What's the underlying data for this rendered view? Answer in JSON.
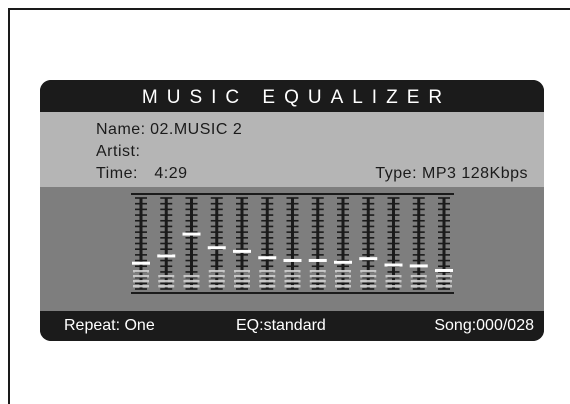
{
  "screen": {
    "title": "MUSIC EQUALIZER",
    "info": {
      "name_label": "Name:",
      "name_value": "02.MUSIC 2",
      "artist_label": "Artist:",
      "artist_value": "",
      "time_label": "Time:",
      "time_value": "4:29",
      "type_label": "Type:",
      "type_value": "MP3 128Kbps"
    },
    "footer": {
      "repeat": "Repeat: One",
      "eq": "EQ:standard",
      "song": "Song:000/028"
    }
  },
  "equalizer": {
    "band_count": 13,
    "peak_levels": [
      0.3,
      0.38,
      0.62,
      0.47,
      0.43,
      0.36,
      0.33,
      0.33,
      0.31,
      0.35,
      0.28,
      0.27,
      0.22
    ],
    "bar_levels": [
      0.22,
      0.2,
      0.2,
      0.24,
      0.26,
      0.21,
      0.22,
      0.22,
      0.24,
      0.25,
      0.19,
      0.16,
      0.16
    ],
    "colors": {
      "background": "#7e7e7e",
      "track": "#1b1b1b",
      "peak": "#ffffff",
      "bar": "#d0d0d0"
    }
  }
}
